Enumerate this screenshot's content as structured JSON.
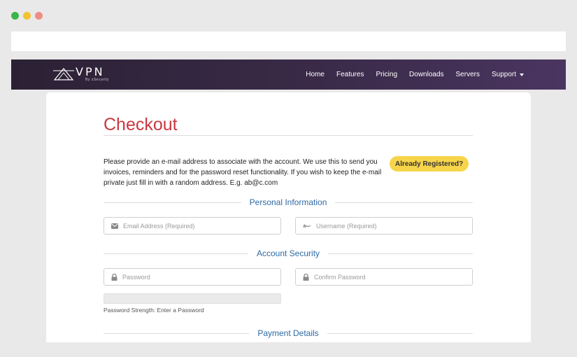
{
  "window": {
    "traffic_lights": [
      {
        "name": "close",
        "color": "#3cb44b"
      },
      {
        "name": "minimize",
        "color": "#f2c230"
      },
      {
        "name": "maximize",
        "color": "#ee8d86"
      }
    ]
  },
  "header": {
    "logo": {
      "main": "VPN",
      "sub": "By zSecurity"
    },
    "nav": {
      "home": "Home",
      "features": "Features",
      "pricing": "Pricing",
      "downloads": "Downloads",
      "servers": "Servers",
      "support": "Support"
    }
  },
  "checkout": {
    "title": "Checkout",
    "intro": "Please provide an e-mail address to associate with the account. We use this to send you invoices, reminders and for the password reset functionality. If you wish to keep the e-mail private just fill in with a random address. E.g. ab@c.com",
    "already_registered": "Already Registered?",
    "sections": {
      "personal": "Personal Information",
      "security": "Account Security",
      "payment": "Payment Details"
    },
    "fields": {
      "email_placeholder": "Email Address (Required)",
      "username_placeholder": "Username (Required)",
      "password_placeholder": "Password",
      "confirm_placeholder": "Confirm Password"
    },
    "password_strength": "Password Strength: Enter a Password"
  },
  "icons": {
    "email": "envelope-icon",
    "username": "signature-icon",
    "password": "lock-icon",
    "confirm": "lock-icon",
    "support": "caret-down-icon"
  },
  "colors": {
    "title": "#c9383f",
    "section_label": "#2e6aa3",
    "badge": "#f7d54a",
    "nav_bg": "#3a2a48"
  }
}
